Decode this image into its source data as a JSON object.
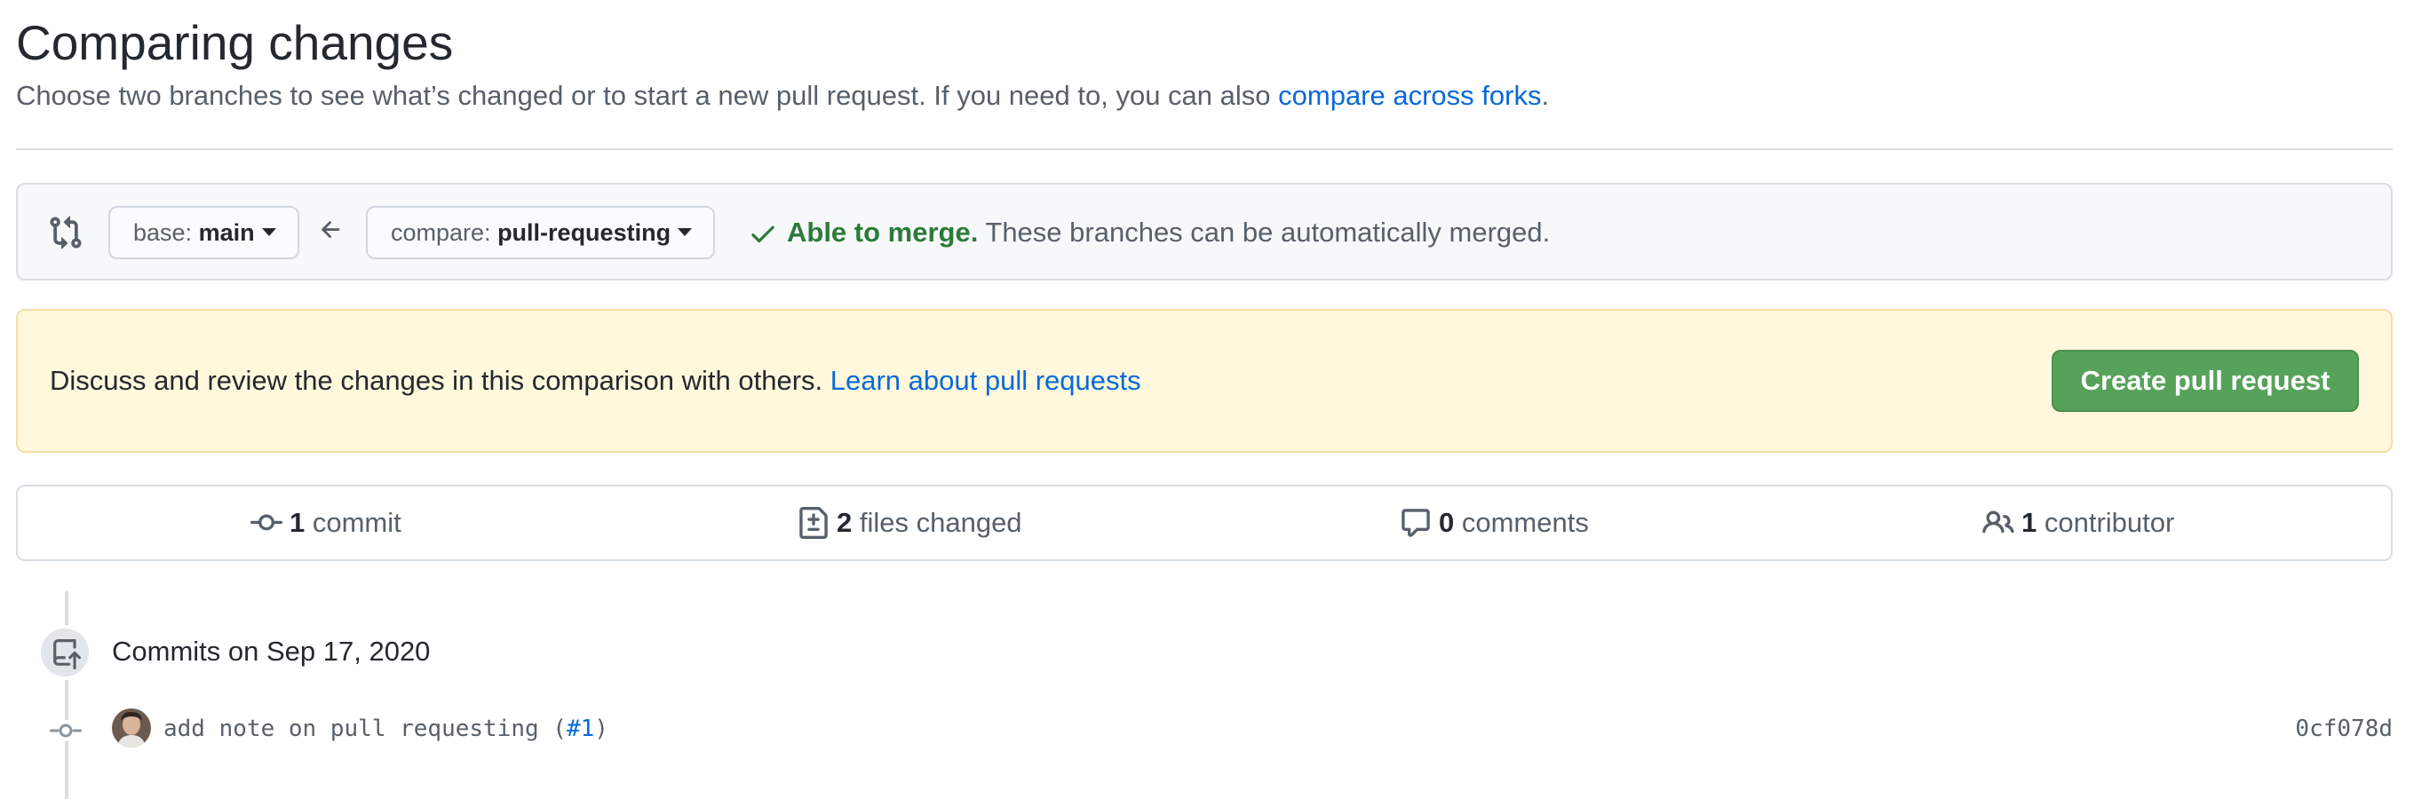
{
  "header": {
    "title": "Comparing changes",
    "subtitle_prefix": "Choose two branches to see what’s changed or to start a new pull request. If you need to, you can also ",
    "subtitle_link": "compare across forks",
    "subtitle_suffix": "."
  },
  "range": {
    "base_prefix": "base: ",
    "base_branch": "main",
    "compare_prefix": "compare: ",
    "compare_branch": "pull-requesting",
    "merge_status_bold": "Able to merge.",
    "merge_status_text": " These branches can be automatically merged."
  },
  "flash": {
    "text": "Discuss and review the changes in this comparison with others. ",
    "link": "Learn about pull requests",
    "create_button": "Create pull request"
  },
  "summary": {
    "commits_count": "1",
    "commits_label": " commit",
    "files_count": "2",
    "files_label": " files changed",
    "comments_count": "0",
    "comments_label": " comments",
    "contributors_count": "1",
    "contributors_label": " contributor"
  },
  "commits": {
    "group_date": "Commits on Sep 17, 2020",
    "items": [
      {
        "message_prefix": "add note on pull requesting (",
        "issue_ref": "#1",
        "message_suffix": ")",
        "sha": "0cf078d"
      }
    ]
  },
  "icons": {
    "compare": "git-compare-icon",
    "arrow": "arrow-left-icon",
    "check": "check-icon",
    "commit": "git-commit-icon",
    "file_diff": "file-diff-icon",
    "comment": "comment-icon",
    "people": "people-icon",
    "repo_push": "repo-push-icon"
  },
  "colors": {
    "link": "#0969da",
    "success": "#2c7a39",
    "button_green": "#56a25a",
    "flash_bg": "#fff8dc"
  }
}
